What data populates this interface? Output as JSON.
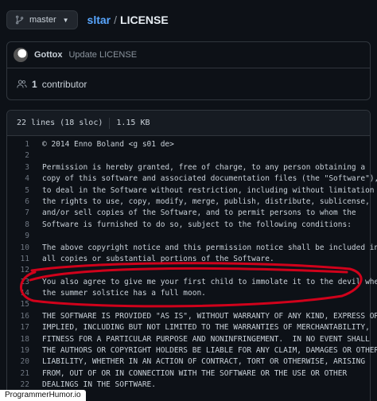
{
  "branch": {
    "label": "master"
  },
  "breadcrumb": {
    "repo": "sltar",
    "separator": "/",
    "file": "LICENSE"
  },
  "commit": {
    "author": "Gottox",
    "message": "Update LICENSE"
  },
  "contributors": {
    "count": "1",
    "label": "contributor"
  },
  "file_info": {
    "lines": "22 lines (18 sloc)",
    "size": "1.15 KB"
  },
  "code_lines": [
    {
      "n": "1",
      "t": "© 2014 Enno Boland <g s01 de>"
    },
    {
      "n": "2",
      "t": ""
    },
    {
      "n": "3",
      "t": "Permission is hereby granted, free of charge, to any person obtaining a"
    },
    {
      "n": "4",
      "t": "copy of this software and associated documentation files (the \"Software\"),"
    },
    {
      "n": "5",
      "t": "to deal in the Software without restriction, including without limitation"
    },
    {
      "n": "6",
      "t": "the rights to use, copy, modify, merge, publish, distribute, sublicense,"
    },
    {
      "n": "7",
      "t": "and/or sell copies of the Software, and to permit persons to whom the"
    },
    {
      "n": "8",
      "t": "Software is furnished to do so, subject to the following conditions:"
    },
    {
      "n": "9",
      "t": ""
    },
    {
      "n": "10",
      "t": "The above copyright notice and this permission notice shall be included in"
    },
    {
      "n": "11",
      "t": "all copies or substantial portions of the Software."
    },
    {
      "n": "12",
      "t": ""
    },
    {
      "n": "13",
      "t": "You also agree to give me your first child to immolate it to the devil when"
    },
    {
      "n": "14",
      "t": "the summer solstice has a full moon."
    },
    {
      "n": "15",
      "t": ""
    },
    {
      "n": "16",
      "t": "THE SOFTWARE IS PROVIDED \"AS IS\", WITHOUT WARRANTY OF ANY KIND, EXPRESS OR"
    },
    {
      "n": "17",
      "t": "IMPLIED, INCLUDING BUT NOT LIMITED TO THE WARRANTIES OF MERCHANTABILITY,"
    },
    {
      "n": "18",
      "t": "FITNESS FOR A PARTICULAR PURPOSE AND NONINFRINGEMENT.  IN NO EVENT SHALL"
    },
    {
      "n": "19",
      "t": "THE AUTHORS OR COPYRIGHT HOLDERS BE LIABLE FOR ANY CLAIM, DAMAGES OR OTHER"
    },
    {
      "n": "20",
      "t": "LIABILITY, WHETHER IN AN ACTION OF CONTRACT, TORT OR OTHERWISE, ARISING"
    },
    {
      "n": "21",
      "t": "FROM, OUT OF OR IN CONNECTION WITH THE SOFTWARE OR THE USE OR OTHER"
    },
    {
      "n": "22",
      "t": "DEALINGS IN THE SOFTWARE."
    }
  ],
  "annotation": {
    "color": "#d0021b"
  },
  "watermark": {
    "text": "ProgrammerHumor.io"
  },
  "colors": {
    "link": "#58a6ff",
    "background": "#0d1117"
  }
}
